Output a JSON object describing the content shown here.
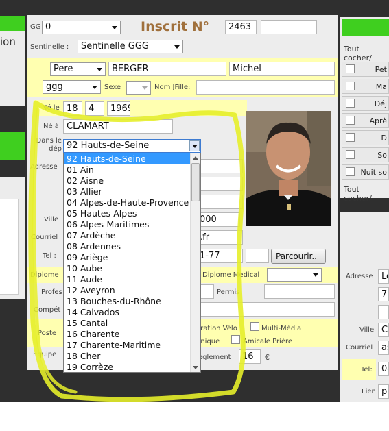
{
  "left_fragment": {
    "text": "ion"
  },
  "header": {
    "gg_label": "GG",
    "gg_value": "0",
    "title": "Inscrit N°",
    "inscrit_number": "2463",
    "sentinelle_label": "Sentinelle :",
    "sentinelle_value": "Sentinelle GGG"
  },
  "identity": {
    "civility": "Pere",
    "last_name": "BERGER",
    "first_name": "Michel",
    "group": "ggg",
    "sexe_label": "Sexe",
    "nom_jfille_label": "Nom JFille:"
  },
  "birth": {
    "ne_le_label": "Né le",
    "day": "18",
    "month": "4",
    "year": "1969",
    "ne_a_label": "Né à",
    "place": "CLAMART",
    "dans_le_dep_label": "Dans le dép",
    "department_selected": "92 Hauts-de-Seine"
  },
  "form": {
    "adresse_label": "Adresse",
    "ville_label": "Ville",
    "ville_partial": "000",
    "courriel_label": "Courriel",
    "courriel_partial": ".fr",
    "tel_label": "Tel :",
    "tel_partial": "1-77",
    "parcourir_label": "Parcourir..",
    "diplome_label": "Diplome",
    "diplome_medical_label": "Diplome Medical",
    "profes_label": "Profes",
    "permis_label": "Permis",
    "compet_label": "Compét",
    "poste_label": "Poste",
    "equipe_label": "Equipe",
    "velo_label": "aration Vélo",
    "multimedia_label": "Multi-Média",
    "nique_label": "nnique",
    "amicale_label": "Amicale Prière",
    "reglement_label": "églement",
    "reglement_value": "16",
    "currency": "€"
  },
  "department_dropdown": {
    "options": [
      "92 Hauts-de-Seine",
      "01 Ain",
      "02 Aisne",
      "03 Allier",
      "04 Alpes-de-Haute-Provence",
      "05 Hautes-Alpes",
      "06 Alpes-Maritimes",
      "07 Ardèche",
      "08 Ardennes",
      "09 Ariège",
      "10 Aube",
      "11 Aude",
      "12 Aveyron",
      "13 Bouches-du-Rhône",
      "14 Calvados",
      "15 Cantal",
      "16 Charente",
      "17 Charente-Maritime",
      "18 Cher",
      "19 Corrèze"
    ],
    "highlighted_index": 0
  },
  "right_panel": {
    "tout_cocher_top": "Tout cocher/",
    "tout_cocher_bottom": "Tout cocher/",
    "rows": [
      "Pet",
      "Ma",
      "Déj",
      "Aprè",
      "D",
      "So",
      "Nuit so"
    ],
    "adresse_label": "Adresse",
    "adresse_partial": "Le",
    "num_partial": "77",
    "ville_label": "Ville",
    "ville_partial": "CA",
    "courriel_label": "Courriel",
    "courriel_partial": "as",
    "tel_label": "Tel:",
    "tel_partial": "04",
    "lien_label": "Lien",
    "lien_partial": "pè"
  },
  "colors": {
    "green": "#3fcf1f",
    "yellow_highlight": "#ffffb0",
    "title_brown": "#a0703c",
    "selection_blue": "#3399ff",
    "annotation_yellow": "#e6ee2a"
  }
}
